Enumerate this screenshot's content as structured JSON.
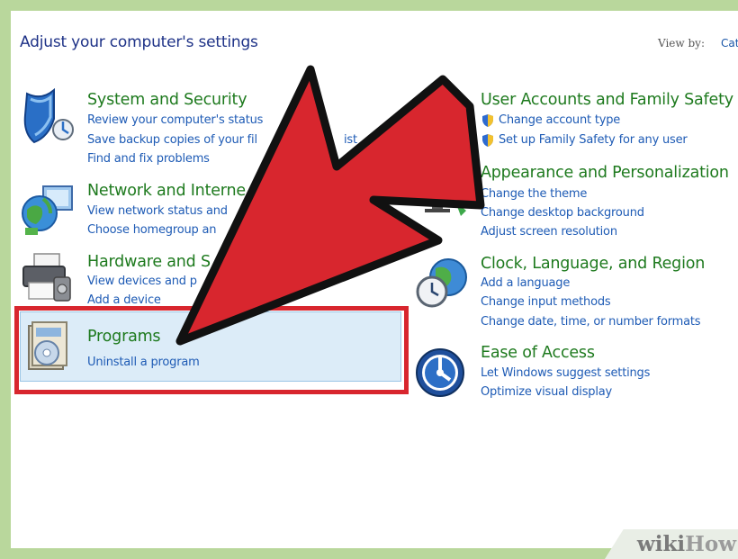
{
  "page": {
    "heading": "Adjust your computer's settings",
    "view_by_label": "View by:",
    "view_by_value": "Cat"
  },
  "categories": {
    "system_security": {
      "title": "System and Security",
      "links": [
        "Review your computer's status",
        "Save backup copies of your fil",
        "ist",
        "Find and fix problems"
      ]
    },
    "network": {
      "title": "Network and Interne",
      "links": [
        "View network status and",
        "Choose homegroup an"
      ]
    },
    "hardware": {
      "title": "Hardware and S",
      "links": [
        "View devices and p",
        "Add a device"
      ]
    },
    "programs": {
      "title": "Programs",
      "links": [
        "Uninstall a program"
      ]
    },
    "user_accounts": {
      "title": "User Accounts and Family Safety",
      "links": [
        "Change account type",
        "Set up Family Safety for any user"
      ]
    },
    "appearance": {
      "title": "Appearance and Personalization",
      "links": [
        "Change the theme",
        "Change desktop background",
        "Adjust screen resolution"
      ]
    },
    "clock": {
      "title": "Clock, Language, and Region",
      "links": [
        "Add a language",
        "Change input methods",
        "Change date, time, or number formats"
      ]
    },
    "ease": {
      "title": "Ease of Access",
      "links": [
        "Let Windows suggest settings",
        "Optimize visual display"
      ]
    }
  },
  "watermark": {
    "wiki": "wiki",
    "how": "How"
  },
  "colors": {
    "frame": "#b9d79c",
    "heading": "#1e3287",
    "category_title": "#1e7a1e",
    "link": "#1e5bb5",
    "highlight_border": "#d8262e",
    "arrow_fill": "#d8262e"
  }
}
